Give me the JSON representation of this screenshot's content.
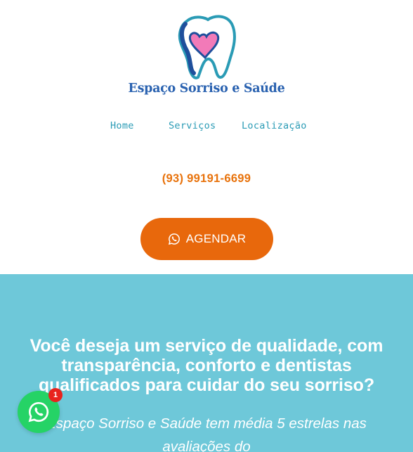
{
  "brand": {
    "name": "Espaço Sorriso e Saúde",
    "logo_icon": "tooth-heart-icon",
    "colors": {
      "primary": "#2a62b0",
      "heart": "#f27ab8",
      "tooth_outline": "#2a9bb5"
    }
  },
  "nav": {
    "items": [
      {
        "label": "Home"
      },
      {
        "label": "Serviços"
      },
      {
        "label": "Localização"
      }
    ],
    "color": "#2a9bb5"
  },
  "contact": {
    "phone": "(93) 99191-6699",
    "color": "#e8720b"
  },
  "cta": {
    "label": "AGENDAR",
    "icon": "whatsapp-icon",
    "color": "#e8680c"
  },
  "hero": {
    "title": "Você deseja um serviço de qualidade, com transparência, conforto e dentistas qualificados para cuidar do seu sorriso?",
    "subtitle": "Espaço Sorriso e Saúde tem média 5 estrelas nas avaliações do",
    "background": "#6ec8d9"
  },
  "whatsapp_widget": {
    "icon": "whatsapp-icon",
    "badge_count": "1",
    "color": "#25d366",
    "badge_color": "#e8231d"
  }
}
